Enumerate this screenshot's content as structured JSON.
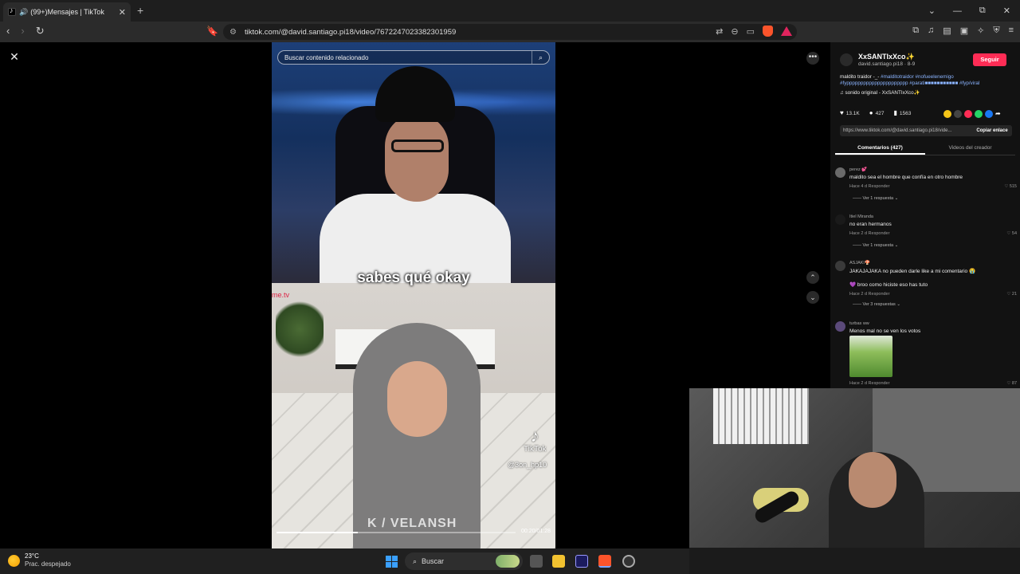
{
  "browser": {
    "tab_title": "(99+)Mensajes | TikTok",
    "tab_speaker": "🔊",
    "tab_close": "✕",
    "new_tab": "+",
    "url": "tiktok.com/@david.santiago.pi18/video/7672247023382301959",
    "window_controls": [
      "⌄",
      "—",
      "⧉",
      "✕"
    ]
  },
  "video": {
    "search_placeholder": "Buscar contenido relacionado",
    "caption": "sabes qué okay",
    "watermark_brand": "TikTok",
    "watermark_handle": "@3on_hp10",
    "brand_overlay": "K / VELANSH",
    "corner_mark": "me.tv",
    "time": "00:20/01:28",
    "progress": 0.34
  },
  "panel": {
    "author_name": "XxSANTIxXco✨",
    "author_sub": "david.santiago.pi18 · 8-9",
    "follow_label": "Seguir",
    "desc_plain": "maldito traidor -_- ",
    "desc_tags": "#malditotraidor #nofueelenemigo #fypppppppppppppppppppppp #parati■■■■■■■■■■■ #fyp/viral",
    "sound": "♫ sonido original - XxSANTIxXco✨",
    "likes": "13.1K",
    "comments_count": "427",
    "saves": "1563",
    "link": "https://www.tiktok.com/@david.santiago.pi18/vide...",
    "copy_label": "Copiar enlace",
    "tab_comments": "Comentarios (427)",
    "tab_videos": "Videos del creador"
  },
  "comments": [
    {
      "user": "perez 💕",
      "text": "maldito sea el hombre que confía en otro hombre",
      "meta": "Hace 4 d   Responder",
      "likes": "♡ 515",
      "replies": "—— Ver 1 respuesta ⌄"
    },
    {
      "user": "Itiel Miranda",
      "text": "no eran hermanos",
      "meta": "Hace 2 d   Responder",
      "likes": "♡ 54",
      "replies": "—— Ver 1 respuesta ⌄"
    },
    {
      "user": "ASJAKI🍄",
      "text": "JAKAJAJAKA no pueden darle like a mi comentario 😭",
      "reply_text": "💜 broo como hiciste eso has tuto",
      "meta": "Hace 2 d   Responder",
      "likes": "♡ 21",
      "replies": "—— Ver 3 respuestas ⌄"
    },
    {
      "user": "turbas ww",
      "text": "Menos mal no se ven los votos",
      "meta": "Hace 2 d   Responder",
      "likes": "♡ 87"
    }
  ],
  "taskbar": {
    "temp": "23°C",
    "condition": "Prac. despejado",
    "search_label": "Buscar"
  },
  "colors": {
    "accent": "#fe2c55",
    "link": "#8bb4ff"
  }
}
